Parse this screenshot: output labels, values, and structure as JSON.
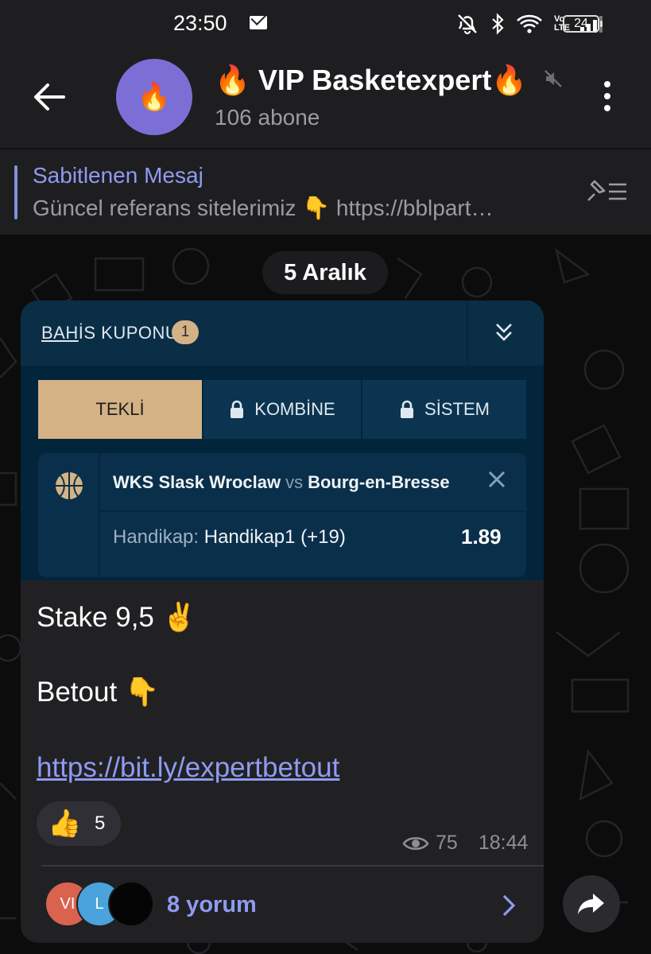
{
  "status_bar": {
    "time": "23:50",
    "battery": "24",
    "network": "Vo LTE"
  },
  "header": {
    "avatar_emoji": "🔥",
    "title": "🔥 VIP Basketexpert🔥",
    "subtitle": "106 abone"
  },
  "pinned": {
    "title": "Sabitlenen Mesaj",
    "text": "Güncel referans sitelerimiz 👇 https://bblpart…"
  },
  "date_chip": "5 Aralık",
  "coupon": {
    "title_underlined": "BAH",
    "title_rest": "İS KUPONU",
    "count": "1",
    "tabs": [
      {
        "label": "TEKLİ",
        "active": true,
        "locked": false
      },
      {
        "label": "KOMBİNE",
        "active": false,
        "locked": true
      },
      {
        "label": "SİSTEM",
        "active": false,
        "locked": true
      }
    ],
    "match": {
      "home": "WKS Slask Wroclaw",
      "vs": "vs",
      "away": "Bourg-en-Bresse",
      "market_label": "Handikap:",
      "market_value": "Handikap1 (+19)",
      "odds": "1.89"
    },
    "colors": {
      "bg": "#03253c",
      "gold": "#d4b285"
    }
  },
  "message": {
    "line1": "Stake 9,5 ✌️",
    "line2": "Betout 👇",
    "link": "https://bit.ly/expertbetout",
    "reaction_emoji": "👍",
    "reaction_count": "5",
    "views": "75",
    "time": "18:44"
  },
  "comments": {
    "avatars": [
      {
        "initials": "VI",
        "color": "#d9634f"
      },
      {
        "initials": "L",
        "color": "#4aa3dd"
      },
      {
        "initials": "",
        "color": "#050505"
      }
    ],
    "label": "8 yorum"
  },
  "accent_color": "#8f9bf0"
}
